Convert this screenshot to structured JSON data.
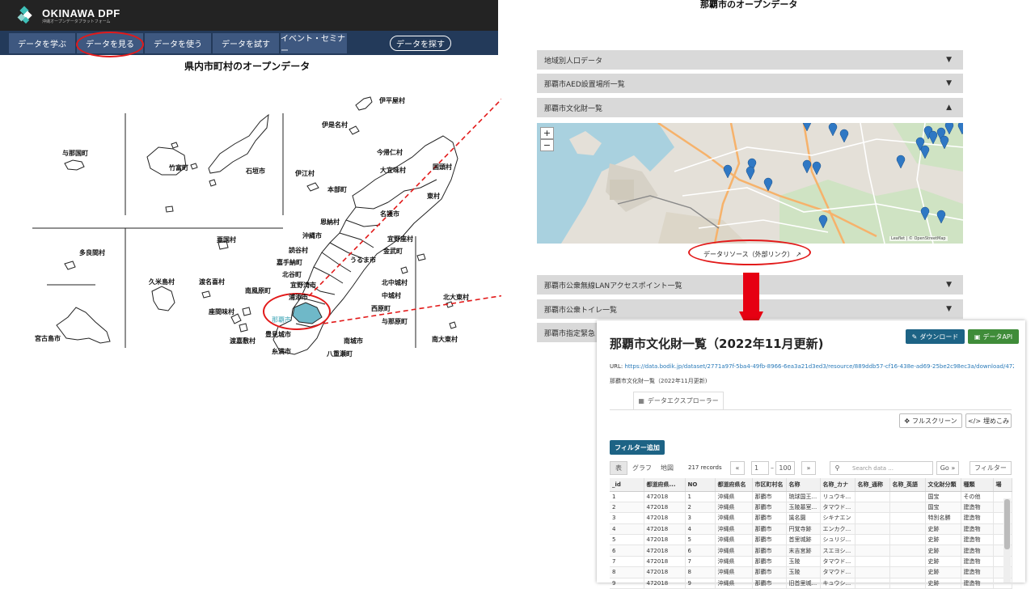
{
  "header": {
    "logo_text": "OKINAWA DPF",
    "logo_sub": "沖縄オープンデータプラットフォーム",
    "nav": [
      "データを学ぶ",
      "データを見る",
      "データを使う",
      "データを試す",
      "イベント・セミナー"
    ],
    "search_label": "データを探す"
  },
  "prefecture": {
    "title": "県内市町村のオープンデータ",
    "labels": [
      "伊平屋村",
      "伊是名村",
      "与那国町",
      "竹富町",
      "石垣市",
      "今帰仁村",
      "伊江村",
      "大宜味村",
      "国頭村",
      "本部町",
      "東村",
      "名護市",
      "恩納村",
      "粟国村",
      "沖縄市",
      "宜野座村",
      "読谷村",
      "金武町",
      "多良間村",
      "嘉手納町",
      "うるま市",
      "北谷町",
      "北中城村",
      "久米島村",
      "渡名喜村",
      "宜野湾市",
      "中城村",
      "南風原町",
      "浦添市",
      "北大東村",
      "座間味村",
      "那覇市",
      "西原町",
      "与那原町",
      "豊見城市",
      "宮古島市",
      "渡嘉敷村",
      "南城市",
      "糸満市",
      "八重瀬町",
      "南大東村"
    ]
  },
  "naha": {
    "title": "那覇市のオープンデータ",
    "accordion": [
      {
        "label": "地域別人口データ",
        "caret": "▼"
      },
      {
        "label": "那覇市AED設置場所一覧",
        "caret": "▼"
      },
      {
        "label": "那覇市文化財一覧",
        "caret": "▲"
      },
      {
        "label": "那覇市公衆無線LANアクセスポイント一覧",
        "caret": "▼"
      },
      {
        "label": "那覇市公衆トイレ一覧",
        "caret": "▼"
      },
      {
        "label": "那覇市指定緊急",
        "caret": "▼"
      }
    ],
    "zoom_in": "+",
    "zoom_out": "−",
    "attribution": "Leaflet | © OpenStreetMap",
    "resource_link": "データリソース（外部リンク）"
  },
  "dataset": {
    "title": "那覇市文化財一覧（2022年11月更新)",
    "download_label": "ダウンロード",
    "api_label": "データAPI",
    "url_key": "URL: ",
    "url": "https://data.bodik.jp/dataset/2771a97f-5ba4-49fb-8966-6ea3a21d3ed3/resource/889ddb57-cf16-438e-ad69-25be2c98ec3a/download/4720...",
    "name": "那覇市文化財一覧（2022年11月更新)",
    "explorer_tab": "データエクスプローラー",
    "fullscreen_label": "フルスクリーン",
    "embed_label": "埋めこみ",
    "filter_add_label": "フィルター追加",
    "views": [
      "表",
      "グラフ",
      "地図"
    ],
    "records": "217 records",
    "pager": {
      "prev": "«",
      "from": "1",
      "dash": "–",
      "to": "100",
      "next": "»"
    },
    "search_placeholder": "Search data ...",
    "go_label": "Go »",
    "filter_label": "フィルター",
    "columns": [
      "_id",
      "都道府県...",
      "NO",
      "都道府県名",
      "市区町村名",
      "名称",
      "名称_カナ",
      "名称_通称",
      "名称_英語",
      "文化財分類",
      "種類",
      "場"
    ],
    "rows": [
      [
        "1",
        "472018",
        "1",
        "沖縄県",
        "那覇市",
        "琉球国王...",
        "リュウキ...",
        "",
        "",
        "国宝",
        "その他",
        ""
      ],
      [
        "2",
        "472018",
        "2",
        "沖縄県",
        "那覇市",
        "玉陵墓室...",
        "タマウド...",
        "",
        "",
        "国宝",
        "建造物",
        ""
      ],
      [
        "3",
        "472018",
        "3",
        "沖縄県",
        "那覇市",
        "識名園",
        "シキナエン",
        "",
        "",
        "特別名勝",
        "建造物",
        ""
      ],
      [
        "4",
        "472018",
        "4",
        "沖縄県",
        "那覇市",
        "円覚寺跡",
        "エンカク...",
        "",
        "",
        "史跡",
        "建造物",
        ""
      ],
      [
        "5",
        "472018",
        "5",
        "沖縄県",
        "那覇市",
        "首里城跡",
        "シュリジ...",
        "",
        "",
        "史跡",
        "建造物",
        ""
      ],
      [
        "6",
        "472018",
        "6",
        "沖縄県",
        "那覇市",
        "末吉宮跡",
        "スエヨシ...",
        "",
        "",
        "史跡",
        "建造物",
        ""
      ],
      [
        "7",
        "472018",
        "7",
        "沖縄県",
        "那覇市",
        "玉陵",
        "タマウド...",
        "",
        "",
        "史跡",
        "建造物",
        ""
      ],
      [
        "8",
        "472018",
        "8",
        "沖縄県",
        "那覇市",
        "玉陵",
        "タマウド...",
        "",
        "",
        "史跡",
        "建造物",
        ""
      ],
      [
        "9",
        "472018",
        "9",
        "沖縄県",
        "那覇市",
        "旧首里城...",
        "キュウシ...",
        "",
        "",
        "史跡",
        "建造物",
        ""
      ]
    ]
  },
  "colors": {
    "highlight": "#e21a1a",
    "nav_bg": "#233a5a",
    "header_bg": "#232323",
    "download": "#1d6385",
    "api": "#3f8c39",
    "naha_fill": "#6fb8c8"
  }
}
